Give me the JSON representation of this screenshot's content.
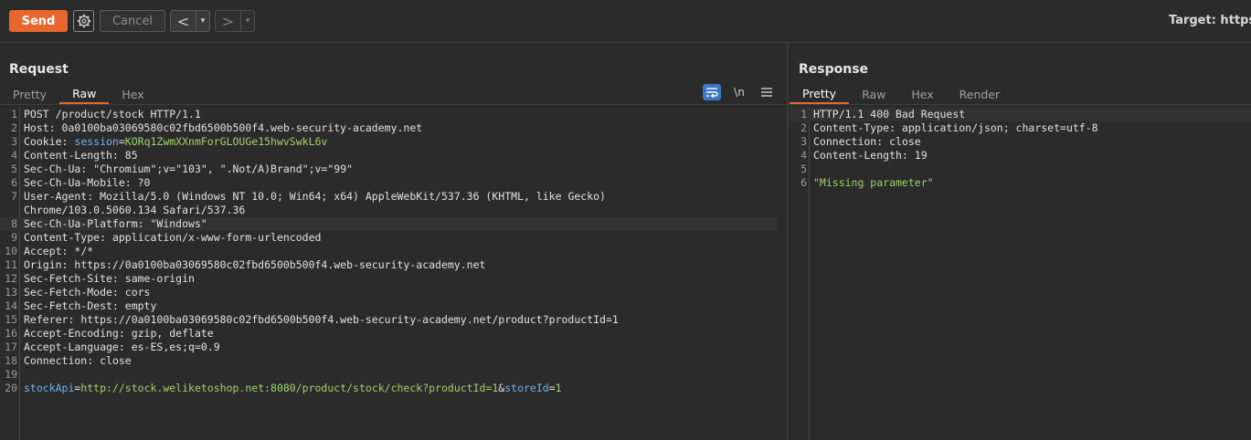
{
  "toolbar": {
    "send_label": "Send",
    "cancel_label": "Cancel",
    "back_arrow": "<",
    "forward_arrow": ">",
    "dropdown_glyph": "▾",
    "target_label": "Target: https"
  },
  "request": {
    "title": "Request",
    "tabs": [
      "Pretty",
      "Raw",
      "Hex"
    ],
    "active_tab": "Raw",
    "newline_toggle": "\\n",
    "lines": [
      {
        "n": "1",
        "k": "POST /product/stock HTTP/1.1",
        "v": ""
      },
      {
        "n": "2",
        "k": "Host: ",
        "v": "0a0100ba03069580c02fbd6500b500f4.web-security-academy.net"
      },
      {
        "n": "3",
        "k": "Cookie: ",
        "b": "session",
        "e": "=",
        "g": "KORq1ZwmXXnmForGLOUGe15hwvSwkL6v"
      },
      {
        "n": "4",
        "k": "Content-Length: ",
        "v": "85"
      },
      {
        "n": "5",
        "k": "Sec-Ch-Ua: ",
        "v": "\"Chromium\";v=\"103\", \".Not/A)Brand\";v=\"99\""
      },
      {
        "n": "6",
        "k": "Sec-Ch-Ua-Mobile: ",
        "v": "?0"
      },
      {
        "n": "7",
        "k": "User-Agent: ",
        "v": "Mozilla/5.0 (Windows NT 10.0; Win64; x64) AppleWebKit/537.36 (KHTML, like Gecko)"
      },
      {
        "n": "",
        "k": "",
        "v": "Chrome/103.0.5060.134 Safari/537.36"
      },
      {
        "n": "8",
        "k": "Sec-Ch-Ua-Platform: ",
        "v": "\"Windows\"",
        "hl": true
      },
      {
        "n": "9",
        "k": "Content-Type: ",
        "v": "application/x-www-form-urlencoded"
      },
      {
        "n": "10",
        "k": "Accept: ",
        "v": "*/*"
      },
      {
        "n": "11",
        "k": "Origin: ",
        "v": "https://0a0100ba03069580c02fbd6500b500f4.web-security-academy.net"
      },
      {
        "n": "12",
        "k": "Sec-Fetch-Site: ",
        "v": "same-origin"
      },
      {
        "n": "13",
        "k": "Sec-Fetch-Mode: ",
        "v": "cors"
      },
      {
        "n": "14",
        "k": "Sec-Fetch-Dest: ",
        "v": "empty"
      },
      {
        "n": "15",
        "k": "Referer: ",
        "v": "https://0a0100ba03069580c02fbd6500b500f4.web-security-academy.net/product?productId=1"
      },
      {
        "n": "16",
        "k": "Accept-Encoding: ",
        "v": "gzip, deflate"
      },
      {
        "n": "17",
        "k": "Accept-Language: ",
        "v": "es-ES,es;q=0.9"
      },
      {
        "n": "18",
        "k": "Connection: ",
        "v": "close"
      },
      {
        "n": "19",
        "k": "",
        "v": ""
      },
      {
        "n": "20",
        "b": "stockApi",
        "e": "=",
        "g": "http://stock.weliketoshop.net:8080/product/stock/check?productId=1",
        "e2": "&",
        "b2": "storeId",
        "e3": "=",
        "g2": "1"
      }
    ]
  },
  "response": {
    "title": "Response",
    "tabs": [
      "Pretty",
      "Raw",
      "Hex",
      "Render"
    ],
    "active_tab": "Pretty",
    "lines": [
      {
        "n": "1",
        "k": "HTTP/1.1 400 Bad Request",
        "v": "",
        "hl": true
      },
      {
        "n": "2",
        "k": "Content-Type: ",
        "v": "application/json; charset=utf-8"
      },
      {
        "n": "3",
        "k": "Connection: ",
        "v": "close"
      },
      {
        "n": "4",
        "k": "Content-Length: ",
        "v": "19"
      },
      {
        "n": "5",
        "k": "",
        "v": ""
      },
      {
        "n": "6",
        "g": "\"Missing parameter\""
      }
    ]
  },
  "colors": {
    "accent": "#e8672e",
    "string_green": "#9fd36a",
    "param_blue": "#6fb3ee",
    "wrap_icon_blue": "#3a78c7"
  }
}
